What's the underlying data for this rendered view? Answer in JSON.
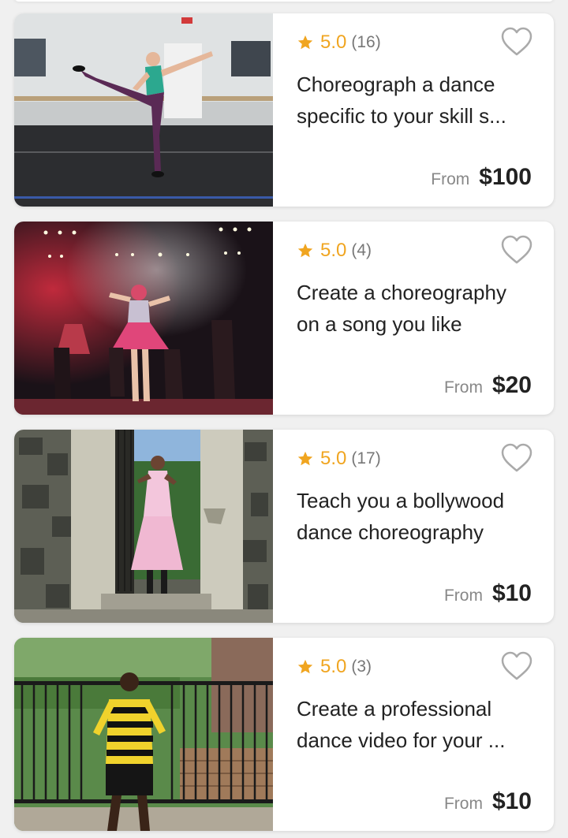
{
  "listings": [
    {
      "rating": "5.0",
      "reviews": "(16)",
      "title_line1": "Choreograph a dance",
      "title_line2": "specific to your skill s...",
      "from_label": "From",
      "price": "$100"
    },
    {
      "rating": "5.0",
      "reviews": "(4)",
      "title_line1": "Create a choreography",
      "title_line2": "on a song you like",
      "from_label": "From",
      "price": "$20"
    },
    {
      "rating": "5.0",
      "reviews": "(17)",
      "title_line1": "Teach you a bollywood",
      "title_line2": "dance choreography",
      "from_label": "From",
      "price": "$10"
    },
    {
      "rating": "5.0",
      "reviews": "(3)",
      "title_line1": "Create a professional",
      "title_line2": "dance video for your ...",
      "from_label": "From",
      "price": "$10"
    }
  ],
  "icons": {
    "rating": "star-icon",
    "favorite": "heart-outline-icon"
  },
  "colors": {
    "rating": "#f0a520",
    "background": "#f0f0f0",
    "card": "#ffffff"
  }
}
